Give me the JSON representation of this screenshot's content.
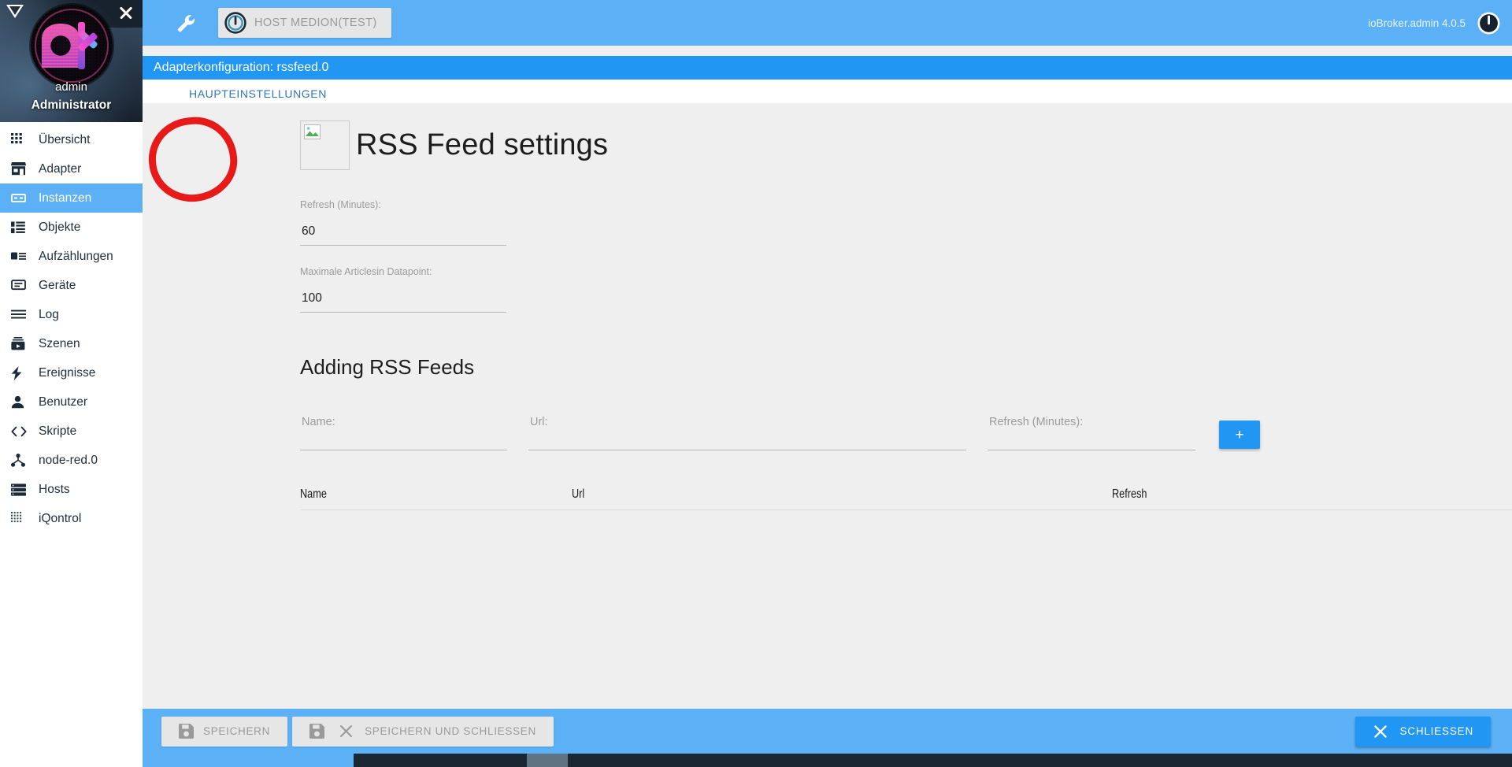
{
  "sidebar": {
    "triangle_icon": "collapse-triangle-icon",
    "close_icon": "close-icon",
    "profile": {
      "name": "admin",
      "role": "Administrator",
      "avatar_icon": "sk-logo-avatar"
    },
    "items": [
      {
        "label": "Übersicht",
        "icon": "grid-icon",
        "active": false
      },
      {
        "label": "Adapter",
        "icon": "shop-icon",
        "active": false
      },
      {
        "label": "Instanzen",
        "icon": "instances-icon",
        "active": true
      },
      {
        "label": "Objekte",
        "icon": "objects-list-icon",
        "active": false
      },
      {
        "label": "Aufzählungen",
        "icon": "enums-icon",
        "active": false
      },
      {
        "label": "Geräte",
        "icon": "device-icon",
        "active": false
      },
      {
        "label": "Log",
        "icon": "lines-icon",
        "active": false
      },
      {
        "label": "Szenen",
        "icon": "scenes-play-icon",
        "active": false
      },
      {
        "label": "Ereignisse",
        "icon": "bolt-icon",
        "active": false
      },
      {
        "label": "Benutzer",
        "icon": "person-icon",
        "active": false
      },
      {
        "label": "Skripte",
        "icon": "code-brackets-icon",
        "active": false
      },
      {
        "label": "node-red.0",
        "icon": "node-red-icon",
        "active": false
      },
      {
        "label": "Hosts",
        "icon": "server-stack-icon",
        "active": false
      },
      {
        "label": "iQontrol",
        "icon": "dots-grid-icon",
        "active": false
      }
    ]
  },
  "topbar": {
    "wrench_icon": "wrench-icon",
    "host_chip": {
      "power_icon": "power-icon",
      "label": "HOST MEDION(TEST)"
    },
    "version": "ioBroker.admin 4.0.5",
    "power_icon": "power-toggle-icon"
  },
  "config": {
    "title": "Adapterkonfiguration: rssfeed.0",
    "tabs": [
      {
        "label": "HAUPTEINSTELLUNGEN",
        "active": true
      }
    ]
  },
  "main": {
    "logo_icon": "broken-image-icon",
    "heading": "RSS Feed settings",
    "fields": [
      {
        "label": "Refresh (Minutes):",
        "value": "60"
      },
      {
        "label": "Maximale Articlesin Datapoint:",
        "value": "100"
      }
    ],
    "section_heading": "Adding RSS Feeds",
    "add_form": {
      "name_placeholder": "Name:",
      "name_value": "",
      "url_placeholder": "Url:",
      "url_value": "",
      "refresh_placeholder": "Refresh (Minutes):",
      "refresh_value": "",
      "add_button_label": "+",
      "add_button_icon": "plus-icon"
    },
    "table": {
      "columns": [
        "Name",
        "Url",
        "Refresh"
      ],
      "rows": []
    }
  },
  "footer": {
    "save_label": "SPEICHERN",
    "save_icon": "floppy-disk-icon",
    "save_close_label": "SPEICHERN UND SCHLIESSEN",
    "save_close_icon": "floppy-disk-icon",
    "save_close_x_icon": "close-x-icon",
    "close_label": "SCHLIESSEN",
    "close_icon": "close-x-icon"
  },
  "annotation": {
    "shape": "red-ellipse-highlight",
    "color": "#e81919",
    "target": "broken-image-icon"
  },
  "colors": {
    "accent_blue": "#2196f3",
    "header_blue": "#5cb0f5",
    "page_bg": "#efefef",
    "sidebar_bg": "#ffffff",
    "taskbar": "#1b2733",
    "annotation_red": "#e81919"
  }
}
